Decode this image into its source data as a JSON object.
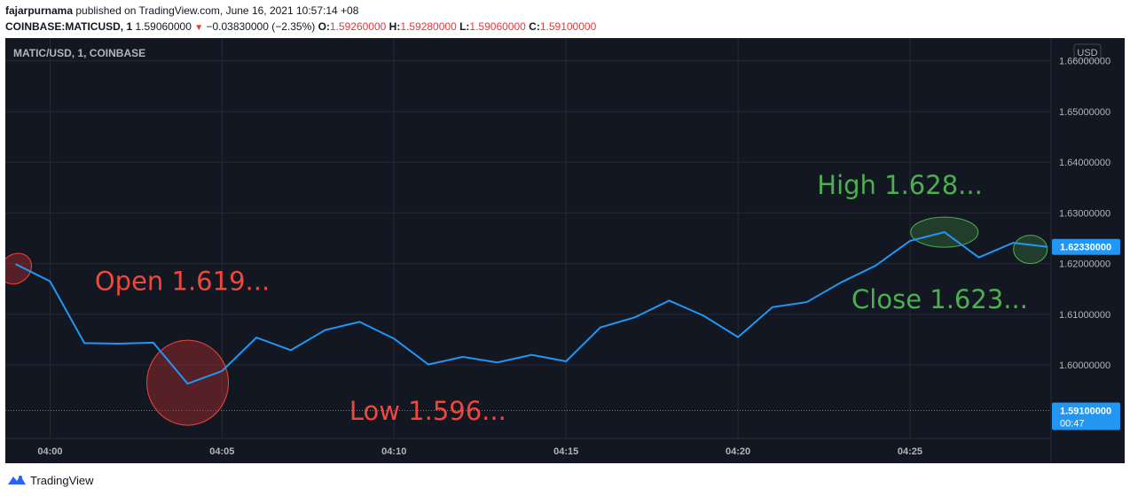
{
  "header": {
    "author": "fajarpurnama",
    "published": " published on TradingView.com, June 16, 2021 10:57:14 +08",
    "symbol": "COINBASE:MATICUSD, 1",
    "last": "1.59060000",
    "change_arrow": "▼",
    "change": "−0.03830000 (−2.35%)",
    "o_label": "O:",
    "o_value": "1.59260000",
    "h_label": "H:",
    "h_value": "1.59280000",
    "l_label": "L:",
    "l_value": "1.59060000",
    "c_label": "C:",
    "c_value": "1.59100000"
  },
  "chart_title": "MATIC/USD, 1, COINBASE",
  "currency_label": "USD",
  "footer": {
    "brand": "TradingView",
    "logo_icon": "tradingview-logo-icon"
  },
  "colors": {
    "background": "#131722",
    "line": "#2196f3",
    "grid": "#262a35",
    "axis_text": "#b2b5be",
    "red_annotation": "#f0463c",
    "green_annotation": "#4caf50"
  },
  "chart_data": {
    "type": "line",
    "title": "MATIC/USD, 1, COINBASE",
    "x": [
      0,
      1,
      2,
      3,
      4,
      5,
      6,
      7,
      8,
      9,
      10,
      11,
      12,
      13,
      14,
      15,
      16,
      17,
      18,
      19,
      20,
      21,
      22,
      23,
      24,
      25,
      26,
      27,
      28,
      29,
      30
    ],
    "x_tick_labels": [
      {
        "x": 1,
        "label": "04:00"
      },
      {
        "x": 6,
        "label": "04:05"
      },
      {
        "x": 11,
        "label": "04:10"
      },
      {
        "x": 16,
        "label": "04:15"
      },
      {
        "x": 21,
        "label": "04:20"
      },
      {
        "x": 26,
        "label": "04:25"
      }
    ],
    "series": [
      {
        "values": [
          1.6199,
          1.6165,
          1.6043,
          1.6042,
          1.6044,
          1.5963,
          1.5988,
          1.6054,
          1.6029,
          1.6069,
          1.6085,
          1.6052,
          1.6001,
          1.6016,
          1.6005,
          1.602,
          1.6007,
          1.6074,
          1.6094,
          1.6127,
          1.6097,
          1.6055,
          1.6114,
          1.6124,
          1.6163,
          1.6196,
          1.6245,
          1.6262,
          1.6212,
          1.6241,
          1.6233
        ]
      }
    ],
    "xlim": [
      -0.3,
      30.1
    ],
    "ylim": [
      1.5855,
      1.6645
    ],
    "y_ticks": [
      "1.66000000",
      "1.65000000",
      "1.64000000",
      "1.63000000",
      "1.62000000",
      "1.61000000",
      "1.60000000"
    ],
    "y_tick_values": [
      1.66,
      1.65,
      1.64,
      1.63,
      1.62,
      1.61,
      1.6
    ],
    "current_price": {
      "value": 1.6233,
      "label": "1.62330000"
    },
    "last_price": {
      "value": 1.591,
      "label": "1.59100000",
      "countdown": "00:47"
    },
    "annotations": [
      {
        "text": "Open 1.619...",
        "x": 2.3,
        "y": 1.6148,
        "color": "red"
      },
      {
        "text": "Low 1.596...",
        "x": 9.7,
        "y": 1.5892,
        "color": "red"
      },
      {
        "text": "High 1.628...",
        "x": 23.3,
        "y": 1.6337,
        "color": "green"
      },
      {
        "text": "Close 1.623...",
        "x": 24.3,
        "y": 1.6112,
        "color": "green"
      }
    ],
    "highlights": [
      {
        "x": 0.0,
        "y": 1.619,
        "color": "red",
        "size": "small"
      },
      {
        "x": 5.0,
        "y": 1.5965,
        "color": "red",
        "size": "large"
      },
      {
        "x": 27.0,
        "y": 1.6262,
        "color": "green",
        "size": "medium"
      },
      {
        "x": 29.5,
        "y": 1.6228,
        "color": "green",
        "size": "small"
      }
    ],
    "grid": true,
    "legend": "none"
  }
}
